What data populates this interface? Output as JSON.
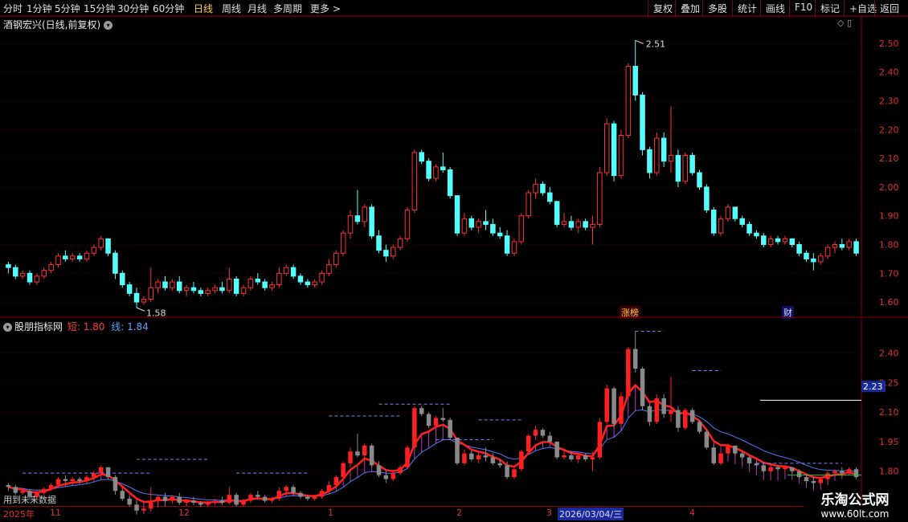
{
  "toolbar": {
    "periods": [
      "分时",
      "1分钟",
      "5分钟",
      "15分钟",
      "30分钟",
      "60分钟",
      "日线",
      "周线",
      "月线",
      "多周期",
      "更多 >"
    ],
    "active": "日线",
    "right": [
      "复权",
      "叠加",
      "多股",
      "统计",
      "画线",
      "F10",
      "标记",
      "+自选",
      "返回"
    ]
  },
  "main": {
    "title": "酒钢宏兴(日线,前复权)",
    "yticks": [
      "2.50",
      "2.40",
      "2.30",
      "2.20",
      "2.10",
      "2.00",
      "1.90",
      "1.80",
      "1.70",
      "1.60"
    ],
    "ytick_values": [
      2.5,
      2.4,
      2.3,
      2.2,
      2.1,
      2.0,
      1.9,
      1.8,
      1.7,
      1.6
    ],
    "high_label": "2.51",
    "low_label": "1.58",
    "tags": {
      "zhangbang": "涨榜",
      "cai": "财"
    },
    "colors": {
      "up": "#ff3030",
      "down": "#54ffff",
      "grid": "#5a0000"
    }
  },
  "indicator": {
    "name": "股朋指标网",
    "short_label": "短: 1.80",
    "line_label": "线: 1.84",
    "yticks": [
      "2.40",
      "2.25",
      "2.10",
      "1.95",
      "1.80"
    ],
    "current_value": "2.23",
    "footer_note": "用到未来数据"
  },
  "date_axis": {
    "year_label": "2025年",
    "labels": [
      "11",
      "12",
      "1",
      "2",
      "3",
      "4"
    ],
    "highlight": "2026/03/04/三"
  },
  "watermark": {
    "title": "乐淘公式网",
    "url": "www.60lt.com"
  },
  "chart_data": {
    "type": "candlestick",
    "title": "酒钢宏兴(日线,前复权)",
    "ylim": [
      1.55,
      2.55
    ],
    "high": 2.51,
    "low": 1.58,
    "ohlc": [
      [
        1.73,
        1.74,
        1.7,
        1.72
      ],
      [
        1.72,
        1.73,
        1.68,
        1.69
      ],
      [
        1.69,
        1.71,
        1.68,
        1.7
      ],
      [
        1.7,
        1.71,
        1.66,
        1.67
      ],
      [
        1.67,
        1.7,
        1.66,
        1.69
      ],
      [
        1.69,
        1.72,
        1.68,
        1.71
      ],
      [
        1.71,
        1.74,
        1.7,
        1.73
      ],
      [
        1.73,
        1.77,
        1.72,
        1.76
      ],
      [
        1.76,
        1.78,
        1.74,
        1.75
      ],
      [
        1.75,
        1.77,
        1.74,
        1.76
      ],
      [
        1.76,
        1.77,
        1.74,
        1.75
      ],
      [
        1.75,
        1.78,
        1.74,
        1.77
      ],
      [
        1.77,
        1.8,
        1.76,
        1.79
      ],
      [
        1.79,
        1.83,
        1.78,
        1.82
      ],
      [
        1.82,
        1.82,
        1.76,
        1.77
      ],
      [
        1.77,
        1.78,
        1.68,
        1.7
      ],
      [
        1.7,
        1.71,
        1.65,
        1.66
      ],
      [
        1.66,
        1.67,
        1.62,
        1.63
      ],
      [
        1.63,
        1.65,
        1.58,
        1.6
      ],
      [
        1.6,
        1.62,
        1.59,
        1.61
      ],
      [
        1.61,
        1.72,
        1.6,
        1.65
      ],
      [
        1.65,
        1.68,
        1.63,
        1.67
      ],
      [
        1.67,
        1.69,
        1.64,
        1.65
      ],
      [
        1.65,
        1.68,
        1.64,
        1.67
      ],
      [
        1.67,
        1.69,
        1.63,
        1.64
      ],
      [
        1.64,
        1.66,
        1.62,
        1.65
      ],
      [
        1.65,
        1.67,
        1.63,
        1.64
      ],
      [
        1.64,
        1.65,
        1.62,
        1.63
      ],
      [
        1.63,
        1.65,
        1.62,
        1.64
      ],
      [
        1.64,
        1.66,
        1.63,
        1.65
      ],
      [
        1.65,
        1.67,
        1.63,
        1.64
      ],
      [
        1.64,
        1.72,
        1.63,
        1.68
      ],
      [
        1.68,
        1.69,
        1.62,
        1.63
      ],
      [
        1.63,
        1.66,
        1.62,
        1.65
      ],
      [
        1.65,
        1.69,
        1.64,
        1.68
      ],
      [
        1.68,
        1.7,
        1.66,
        1.67
      ],
      [
        1.67,
        1.68,
        1.64,
        1.65
      ],
      [
        1.65,
        1.67,
        1.64,
        1.66
      ],
      [
        1.66,
        1.72,
        1.65,
        1.7
      ],
      [
        1.7,
        1.73,
        1.69,
        1.72
      ],
      [
        1.72,
        1.73,
        1.68,
        1.69
      ],
      [
        1.69,
        1.7,
        1.66,
        1.67
      ],
      [
        1.67,
        1.68,
        1.65,
        1.66
      ],
      [
        1.66,
        1.68,
        1.65,
        1.67
      ],
      [
        1.67,
        1.71,
        1.66,
        1.7
      ],
      [
        1.7,
        1.75,
        1.69,
        1.73
      ],
      [
        1.73,
        1.78,
        1.72,
        1.77
      ],
      [
        1.77,
        1.85,
        1.76,
        1.84
      ],
      [
        1.84,
        1.92,
        1.82,
        1.9
      ],
      [
        1.9,
        1.99,
        1.87,
        1.88
      ],
      [
        1.88,
        1.94,
        1.86,
        1.93
      ],
      [
        1.93,
        1.94,
        1.82,
        1.83
      ],
      [
        1.83,
        1.85,
        1.77,
        1.78
      ],
      [
        1.78,
        1.8,
        1.74,
        1.76
      ],
      [
        1.76,
        1.8,
        1.75,
        1.79
      ],
      [
        1.79,
        1.83,
        1.78,
        1.82
      ],
      [
        1.82,
        1.93,
        1.81,
        1.92
      ],
      [
        1.92,
        2.13,
        1.91,
        2.12
      ],
      [
        2.12,
        2.13,
        2.08,
        2.09
      ],
      [
        2.09,
        2.1,
        2.02,
        2.03
      ],
      [
        2.03,
        2.08,
        2.02,
        2.07
      ],
      [
        2.07,
        2.12,
        2.05,
        2.06
      ],
      [
        2.06,
        2.07,
        1.96,
        1.97
      ],
      [
        1.97,
        1.97,
        1.83,
        1.84
      ],
      [
        1.84,
        1.91,
        1.83,
        1.89
      ],
      [
        1.89,
        1.9,
        1.85,
        1.86
      ],
      [
        1.86,
        1.89,
        1.84,
        1.88
      ],
      [
        1.88,
        1.92,
        1.85,
        1.87
      ],
      [
        1.87,
        1.89,
        1.83,
        1.84
      ],
      [
        1.84,
        1.86,
        1.82,
        1.83
      ],
      [
        1.83,
        1.85,
        1.76,
        1.77
      ],
      [
        1.77,
        1.82,
        1.76,
        1.81
      ],
      [
        1.81,
        1.91,
        1.8,
        1.9
      ],
      [
        1.9,
        1.99,
        1.89,
        1.98
      ],
      [
        1.98,
        2.03,
        1.96,
        2.01
      ],
      [
        2.01,
        2.02,
        1.97,
        1.98
      ],
      [
        1.98,
        2.0,
        1.94,
        1.95
      ],
      [
        1.95,
        1.95,
        1.86,
        1.87
      ],
      [
        1.87,
        1.91,
        1.86,
        1.88
      ],
      [
        1.88,
        1.9,
        1.85,
        1.86
      ],
      [
        1.86,
        1.89,
        1.84,
        1.88
      ],
      [
        1.88,
        1.89,
        1.85,
        1.86
      ],
      [
        1.86,
        1.9,
        1.8,
        1.87
      ],
      [
        1.87,
        2.07,
        1.86,
        2.05
      ],
      [
        2.05,
        2.24,
        2.04,
        2.22
      ],
      [
        2.22,
        2.23,
        2.02,
        2.04
      ],
      [
        2.04,
        2.2,
        2.03,
        2.18
      ],
      [
        2.18,
        2.43,
        2.17,
        2.42
      ],
      [
        2.42,
        2.51,
        2.3,
        2.32
      ],
      [
        2.32,
        2.33,
        2.11,
        2.13
      ],
      [
        2.13,
        2.14,
        2.03,
        2.05
      ],
      [
        2.05,
        2.19,
        2.04,
        2.17
      ],
      [
        2.17,
        2.19,
        2.07,
        2.09
      ],
      [
        2.09,
        2.28,
        2.05,
        2.11
      ],
      [
        2.11,
        2.13,
        2.0,
        2.02
      ],
      [
        2.02,
        2.12,
        2.01,
        2.11
      ],
      [
        2.11,
        2.12,
        2.04,
        2.05
      ],
      [
        2.05,
        2.06,
        1.99,
        2.0
      ],
      [
        2.0,
        2.01,
        1.91,
        1.92
      ],
      [
        1.92,
        1.93,
        1.83,
        1.84
      ],
      [
        1.84,
        1.9,
        1.83,
        1.89
      ],
      [
        1.89,
        1.94,
        1.88,
        1.93
      ],
      [
        1.93,
        1.93,
        1.88,
        1.89
      ],
      [
        1.89,
        1.9,
        1.86,
        1.87
      ],
      [
        1.87,
        1.88,
        1.83,
        1.84
      ],
      [
        1.84,
        1.85,
        1.82,
        1.83
      ],
      [
        1.83,
        1.84,
        1.79,
        1.8
      ],
      [
        1.8,
        1.83,
        1.79,
        1.82
      ],
      [
        1.82,
        1.83,
        1.8,
        1.81
      ],
      [
        1.81,
        1.83,
        1.8,
        1.82
      ],
      [
        1.82,
        1.82,
        1.79,
        1.8
      ],
      [
        1.8,
        1.81,
        1.76,
        1.77
      ],
      [
        1.77,
        1.78,
        1.74,
        1.75
      ],
      [
        1.75,
        1.77,
        1.71,
        1.74
      ],
      [
        1.74,
        1.77,
        1.73,
        1.76
      ],
      [
        1.76,
        1.8,
        1.75,
        1.79
      ],
      [
        1.79,
        1.81,
        1.77,
        1.8
      ],
      [
        1.8,
        1.82,
        1.78,
        1.79
      ],
      [
        1.79,
        1.82,
        1.78,
        1.81
      ],
      [
        1.81,
        1.82,
        1.76,
        1.77
      ]
    ]
  }
}
